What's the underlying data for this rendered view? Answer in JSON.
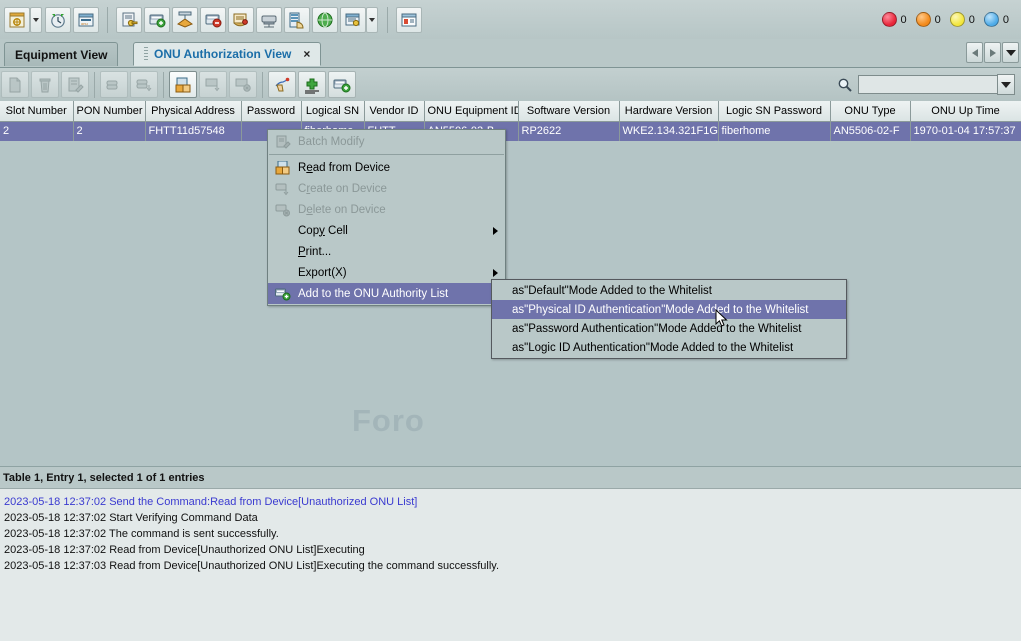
{
  "toolbar": {
    "buttons": [
      {
        "name": "topology-icon",
        "title": "Topology"
      },
      {
        "name": "topology-dropdown-arrow",
        "title": "Topology options"
      },
      {
        "name": "timer-icon",
        "title": "Timer Task"
      },
      {
        "name": "onu-list-icon",
        "title": "ONU List"
      },
      {
        "name": "account-key-icon",
        "title": "Account Authority"
      },
      {
        "name": "device-add-icon",
        "title": "Add Device"
      },
      {
        "name": "network-scan-icon",
        "title": "Scan Network"
      },
      {
        "name": "device-remove-icon",
        "title": "Delete Device"
      },
      {
        "name": "alarm-notice-icon",
        "title": "Alarm"
      },
      {
        "name": "server-icon",
        "title": "Server"
      },
      {
        "name": "rack-manage-icon",
        "title": "Rack"
      },
      {
        "name": "globe-icon",
        "title": "Web"
      },
      {
        "name": "report-icon",
        "title": "Report"
      },
      {
        "name": "report-dropdown-arrow",
        "title": "Report options"
      },
      {
        "name": "window-icon",
        "title": "Window"
      }
    ],
    "status_leds": [
      {
        "name": "critical-alarm-led",
        "color": "#e8263a",
        "count": "0"
      },
      {
        "name": "major-alarm-led",
        "color": "#f38a1a",
        "count": "0"
      },
      {
        "name": "minor-alarm-led",
        "color": "#f2e63c",
        "count": "0"
      },
      {
        "name": "warning-alarm-led",
        "color": "#4eabe8",
        "count": "0"
      }
    ]
  },
  "tabs": {
    "items": [
      {
        "label": "Equipment View",
        "active": false
      },
      {
        "label": "ONU Authorization View",
        "active": true
      }
    ],
    "close_label": "×"
  },
  "toolbar2": {
    "buttons": [
      {
        "name": "new-icon",
        "title": "New"
      },
      {
        "name": "delete-icon",
        "title": "Delete"
      },
      {
        "name": "modify-icon",
        "title": "Modify"
      },
      {
        "name": "copy-records-icon",
        "title": "Copy Records"
      },
      {
        "name": "save-records-icon",
        "title": "Save Records"
      },
      {
        "name": "read-from-device-icon",
        "title": "Read from Device"
      },
      {
        "name": "create-on-device-icon",
        "title": "Create on Device"
      },
      {
        "name": "delete-on-device-icon",
        "title": "Delete on Device"
      },
      {
        "name": "select-point-icon",
        "title": "Select"
      },
      {
        "name": "add-row-icon",
        "title": "Add Row"
      },
      {
        "name": "add-to-whitelist-icon",
        "title": "Add to ONU Authority List"
      }
    ],
    "search": {
      "icon": "search-icon",
      "value": "",
      "placeholder": "",
      "dropdown_icon": "chevron-down-icon"
    }
  },
  "table": {
    "columns": [
      "Slot Number",
      "PON Number",
      "Physical Address",
      "Password",
      "Logical SN",
      "Vendor ID",
      "ONU Equipment ID",
      "Software Version",
      "Hardware Version",
      "Logic SN Password",
      "ONU Type",
      "ONU Up Time"
    ],
    "rows": [
      {
        "slot_number": "2",
        "pon_number": "2",
        "physical_address": "FHTT11d57548",
        "password": "",
        "logical_sn": "fiberhome",
        "vendor_id": "FHTT",
        "onu_equipment_id": "AN5506-02-B",
        "software_version": "RP2622",
        "hardware_version": "WKE2.134.321F1G",
        "logic_sn_password": "fiberhome",
        "onu_type": "AN5506-02-F",
        "onu_up_time": "1970-01-04 17:57:37"
      }
    ],
    "watermark": "Foro"
  },
  "status": {
    "text": "Table 1, Entry 1, selected 1 of 1 entries"
  },
  "context_menu": {
    "items": [
      {
        "label": "Batch Modify",
        "mnemonic": "",
        "disabled": true,
        "icon": "batch-modify-icon",
        "submenu": false
      },
      {
        "label": "Read from Device",
        "mnemonic": "a",
        "disabled": false,
        "icon": "read-from-device-icon",
        "submenu": false
      },
      {
        "label": "Create on Device",
        "mnemonic": "r",
        "disabled": true,
        "icon": "create-on-device-icon",
        "submenu": false
      },
      {
        "label": "Delete on Device",
        "mnemonic": "e",
        "disabled": true,
        "icon": "delete-on-device-icon",
        "submenu": false
      },
      {
        "label": "Copy Cell",
        "mnemonic": "y",
        "disabled": false,
        "icon": "",
        "submenu": true
      },
      {
        "label": "Print...",
        "mnemonic": "r",
        "disabled": false,
        "icon": "",
        "submenu": false
      },
      {
        "label": "Export(X)",
        "mnemonic": "",
        "disabled": false,
        "icon": "",
        "submenu": true
      },
      {
        "label": "Add to the ONU Authority List",
        "mnemonic": "",
        "disabled": false,
        "icon": "add-to-whitelist-icon",
        "submenu": true,
        "highlighted": true
      }
    ]
  },
  "submenu": {
    "items": [
      {
        "label": "as\"Default\"Mode Added to the Whitelist",
        "highlighted": false
      },
      {
        "label": "as\"Physical ID Authentication\"Mode Added to the Whitelist",
        "highlighted": true
      },
      {
        "label": "as\"Password Authentication\"Mode Added to the Whitelist",
        "highlighted": false
      },
      {
        "label": "as\"Logic ID Authentication\"Mode Added to the Whitelist",
        "highlighted": false
      }
    ]
  },
  "log": {
    "lines": [
      {
        "text": "2023-05-18 12:37:02 Send the Command:Read from Device[Unauthorized ONU List]",
        "highlight": true
      },
      {
        "text": "2023-05-18 12:37:02 Start Verifying Command Data",
        "highlight": false
      },
      {
        "text": "2023-05-18 12:37:02 The command is sent successfully.",
        "highlight": false
      },
      {
        "text": "2023-05-18 12:37:02 Read from Device[Unauthorized ONU List]Executing",
        "highlight": false
      },
      {
        "text": "2023-05-18 12:37:03 Read from Device[Unauthorized ONU List]Executing the command successfully.",
        "highlight": false
      }
    ]
  },
  "colors": {
    "selection": "#6f73ab",
    "app_background": "#b9c8c8",
    "table_background": "#b4c5c6",
    "log_background": "#e3e9e9",
    "tab_active_text": "#1b6ea8",
    "log_highlight": "#3a3ad0"
  }
}
